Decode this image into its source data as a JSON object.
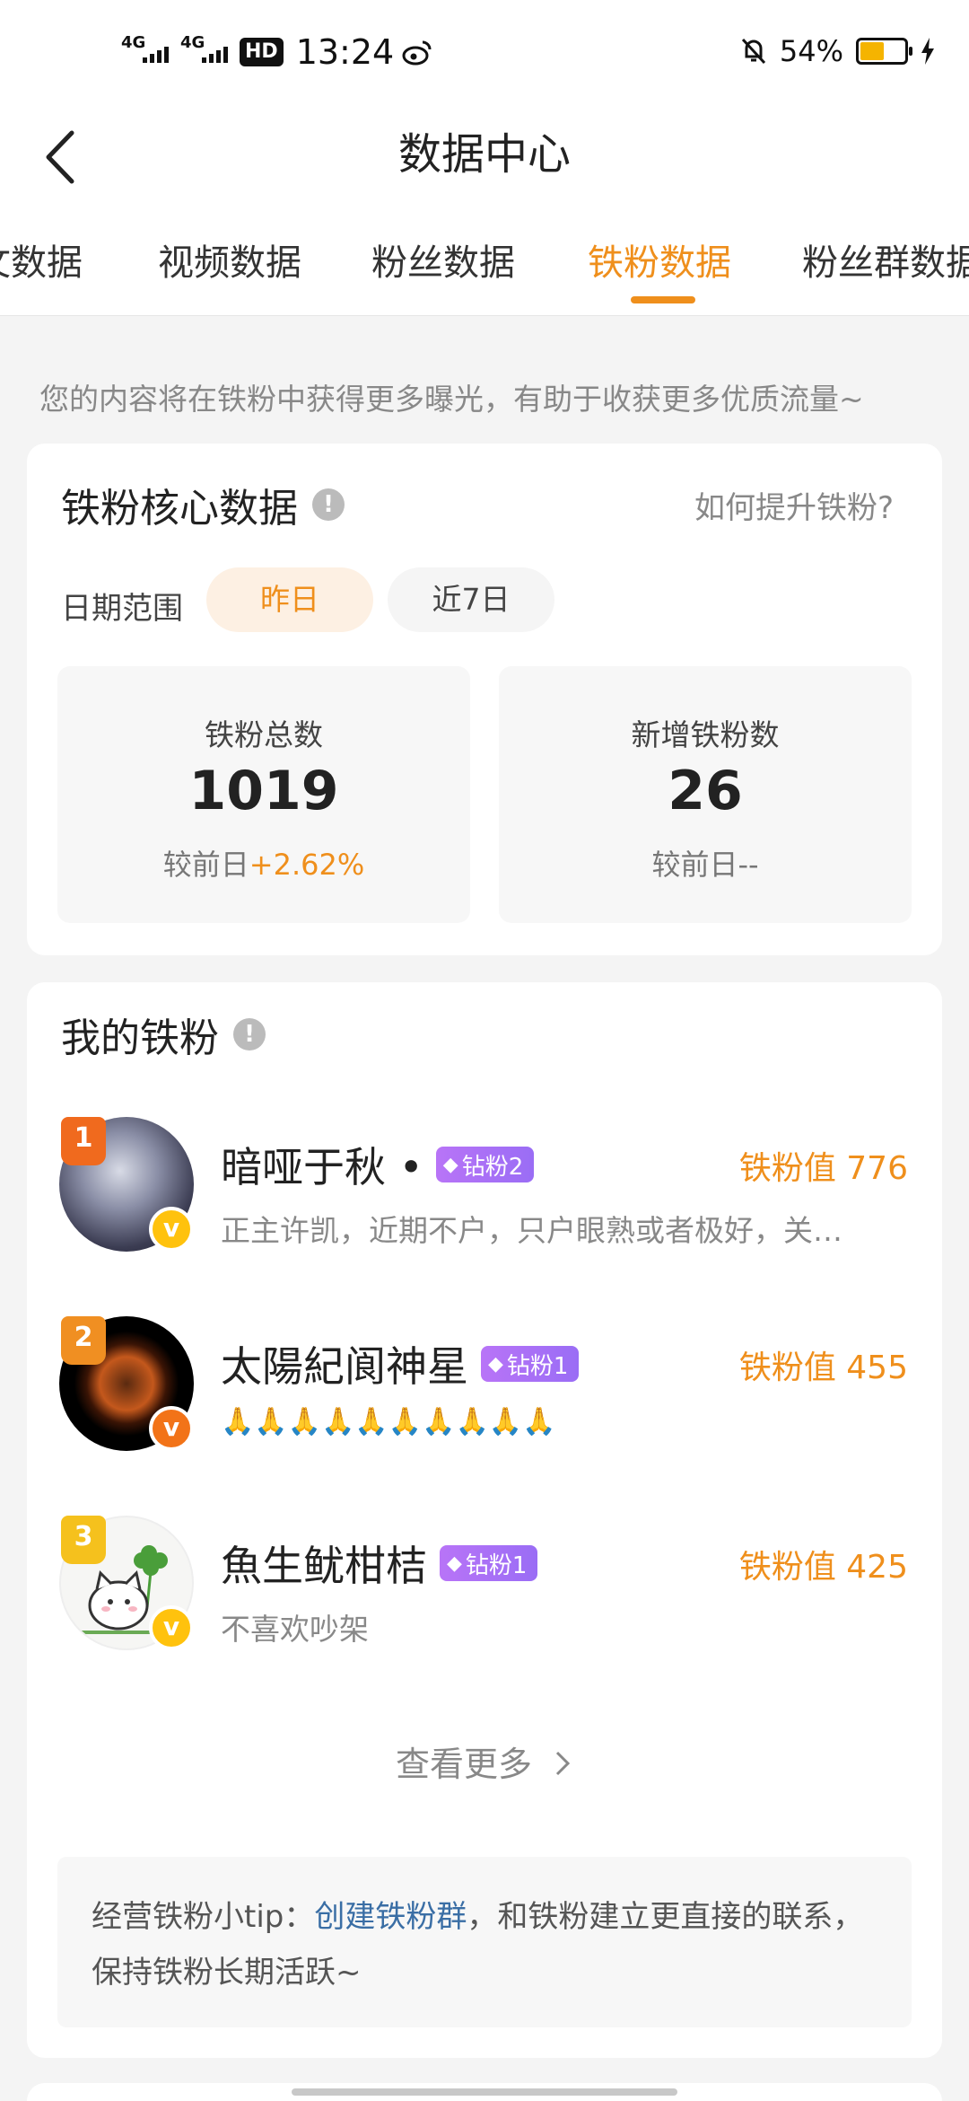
{
  "status_bar": {
    "net1": "4G",
    "net2": "4G",
    "hd": "HD",
    "time": "13:24",
    "battery_text": "54%",
    "battery_level": 0.54
  },
  "header": {
    "title": "数据中心"
  },
  "tabs": [
    {
      "label": "文数据"
    },
    {
      "label": "视频数据"
    },
    {
      "label": "粉丝数据"
    },
    {
      "label": "铁粉数据",
      "active": true
    },
    {
      "label": "粉丝群数据"
    }
  ],
  "intro": "您的内容将在铁粉中获得更多曝光，有助于收获更多优质流量~",
  "core": {
    "title": "铁粉核心数据",
    "info": "!",
    "how_link": "如何提升铁粉?",
    "date_label": "日期范围",
    "date_options": [
      "昨日",
      "近7日"
    ],
    "stats": [
      {
        "label": "铁粉总数",
        "value": "1019",
        "compare_prefix": "较前日",
        "compare_value": "+2.62%"
      },
      {
        "label": "新增铁粉数",
        "value": "26",
        "compare_prefix": "较前日",
        "compare_value": "--"
      }
    ]
  },
  "my_fans": {
    "title": "我的铁粉",
    "info": "!",
    "fans": [
      {
        "rank": "1",
        "name": "暗哑于秋 •",
        "badge": "钻粉2",
        "value": "铁粉值 776",
        "desc": "正主许凯，近期不户，只户眼熟或者极好，关…"
      },
      {
        "rank": "2",
        "name": "太陽紀阆神星",
        "badge": "钻粉1",
        "value": "铁粉值 455",
        "desc": "🙏🙏🙏🙏🙏🙏🙏🙏🙏🙏"
      },
      {
        "rank": "3",
        "name": "魚生鱿柑桔",
        "badge": "钻粉1",
        "value": "铁粉值 425",
        "desc": "不喜欢吵架"
      }
    ],
    "more": "查看更多",
    "tip_prefix": "经营铁粉小tip：",
    "tip_link": "创建铁粉群",
    "tip_suffix": "，和铁粉建立更直接的联系，保持铁粉长期活跃~"
  },
  "colors": {
    "accent": "#ef8f1c",
    "link": "#3a6ea5",
    "badge": "#a66ff6"
  }
}
